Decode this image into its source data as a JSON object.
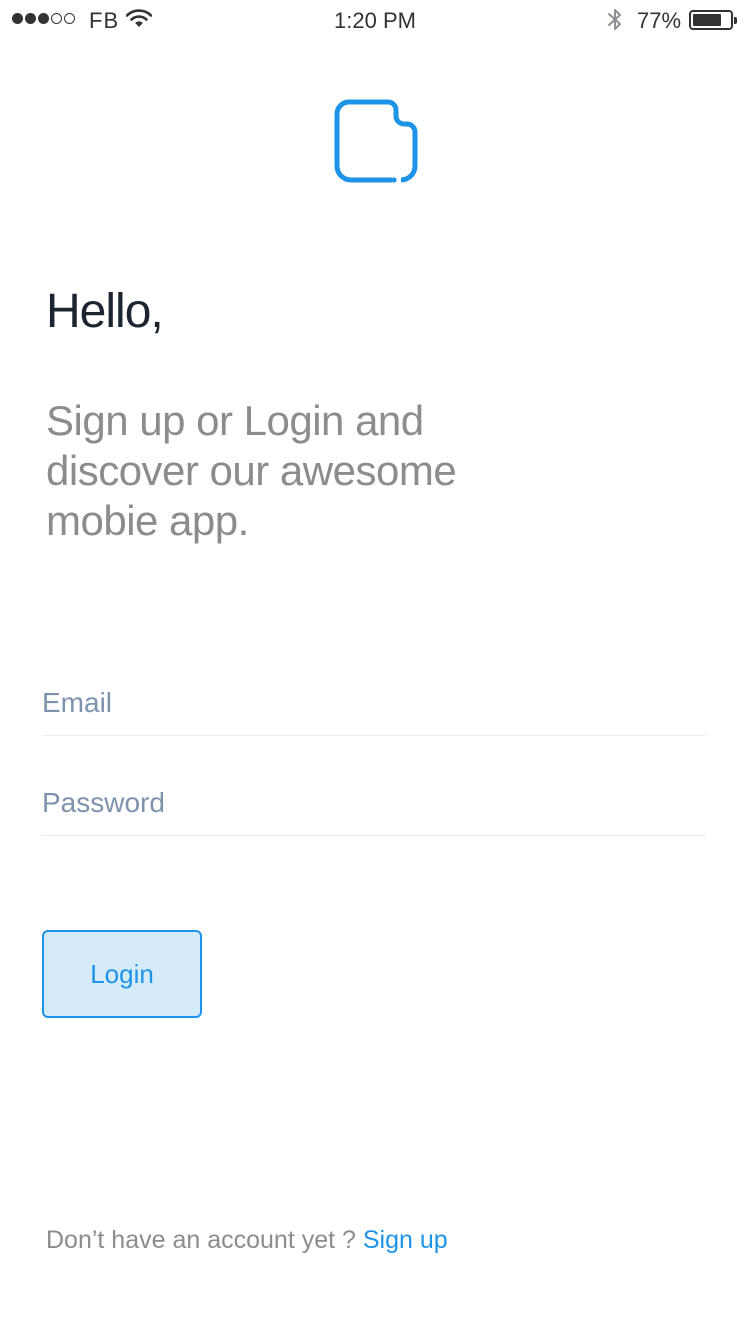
{
  "status_bar": {
    "carrier": "FB",
    "time": "1:20 PM",
    "battery_percent": "77%",
    "battery_level": 0.77,
    "signal_bars_filled": 3,
    "signal_bars_total": 5,
    "icons": [
      "signal-dots-icon",
      "wifi-icon",
      "bluetooth-icon",
      "battery-icon"
    ]
  },
  "logo": {
    "icon": "app-logo-icon",
    "color": "#1E94E8"
  },
  "header": {
    "greeting": "Hello,",
    "tagline": "Sign up or Login and discover our awesome mobie app."
  },
  "form": {
    "email_placeholder": "Email",
    "email_value": "",
    "password_placeholder": "Password",
    "password_value": "",
    "login_label": "Login"
  },
  "footer": {
    "prompt": "Don’t have an account yet ?",
    "signup_label": "Sign up"
  },
  "colors": {
    "accent": "#1E94E8",
    "button_bg": "#D6EBF9",
    "heading": "#1B2530",
    "muted_text": "#8C8C8C",
    "placeholder": "#7D93AD"
  }
}
